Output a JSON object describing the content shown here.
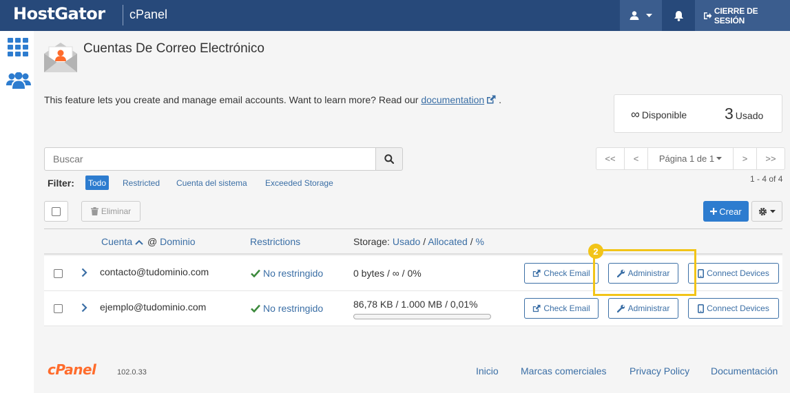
{
  "header": {
    "brand": "HostGator",
    "product": "cPanel",
    "logout_label": "CIERRE DE SESIÓN"
  },
  "sidebar": {
    "items": [
      {
        "icon": "grid-icon"
      },
      {
        "icon": "users-icon"
      }
    ]
  },
  "page": {
    "title": "Cuentas De Correo Electrónico",
    "description": "This feature lets you create and manage email accounts. Want to learn more? Read our",
    "doc_link": "documentation",
    "desc_end": "."
  },
  "stats": {
    "available_symbol": "∞",
    "available_label": "Disponible",
    "used_value": "3",
    "used_label": "Usado"
  },
  "search": {
    "placeholder": "Buscar"
  },
  "pagination": {
    "first": "<<",
    "prev": "<",
    "page_label": "Página 1 de 1",
    "next": ">",
    "last": ">>",
    "count": "1 - 4 of 4"
  },
  "filters": {
    "label": "Filter:",
    "items": [
      "Todo",
      "Restricted",
      "Cuenta del sistema",
      "Exceeded Storage"
    ],
    "active": "Todo"
  },
  "toolbar": {
    "delete_label": "Eliminar",
    "create_label": "Crear"
  },
  "table": {
    "col_account": "Cuenta",
    "col_at": "@",
    "col_domain": "Dominio",
    "col_restrictions": "Restrictions",
    "col_storage_prefix": "Storage:",
    "col_used": "Usado",
    "col_sep": "/",
    "col_allocated": "Allocated",
    "col_percent": "%",
    "rows": [
      {
        "email": "contacto@tudominio.com",
        "restriction": "No restringido",
        "storage": "0 bytes / ∞ / 0%",
        "usage_percent": 0,
        "check_email": "Check Email",
        "manage": "Administrar",
        "connect": "Connect Devices"
      },
      {
        "email": "ejemplo@tudominio.com",
        "restriction": "No restringido",
        "storage": "86,78 KB / 1.000 MB / 0,01%",
        "usage_percent": 0.01,
        "check_email": "Check Email",
        "manage": "Administrar",
        "connect": "Connect Devices"
      }
    ]
  },
  "annotation": {
    "step": "2",
    "color": "#f2c418"
  },
  "footer": {
    "logo": "cPanel",
    "version": "102.0.33",
    "links": [
      "Inicio",
      "Marcas comerciales",
      "Privacy Policy",
      "Documentación"
    ]
  },
  "colors": {
    "header_bg": "#27497a",
    "accent": "#2d7ccf",
    "link": "#3a6ea5",
    "cpanel_orange": "#ff6c2c"
  }
}
